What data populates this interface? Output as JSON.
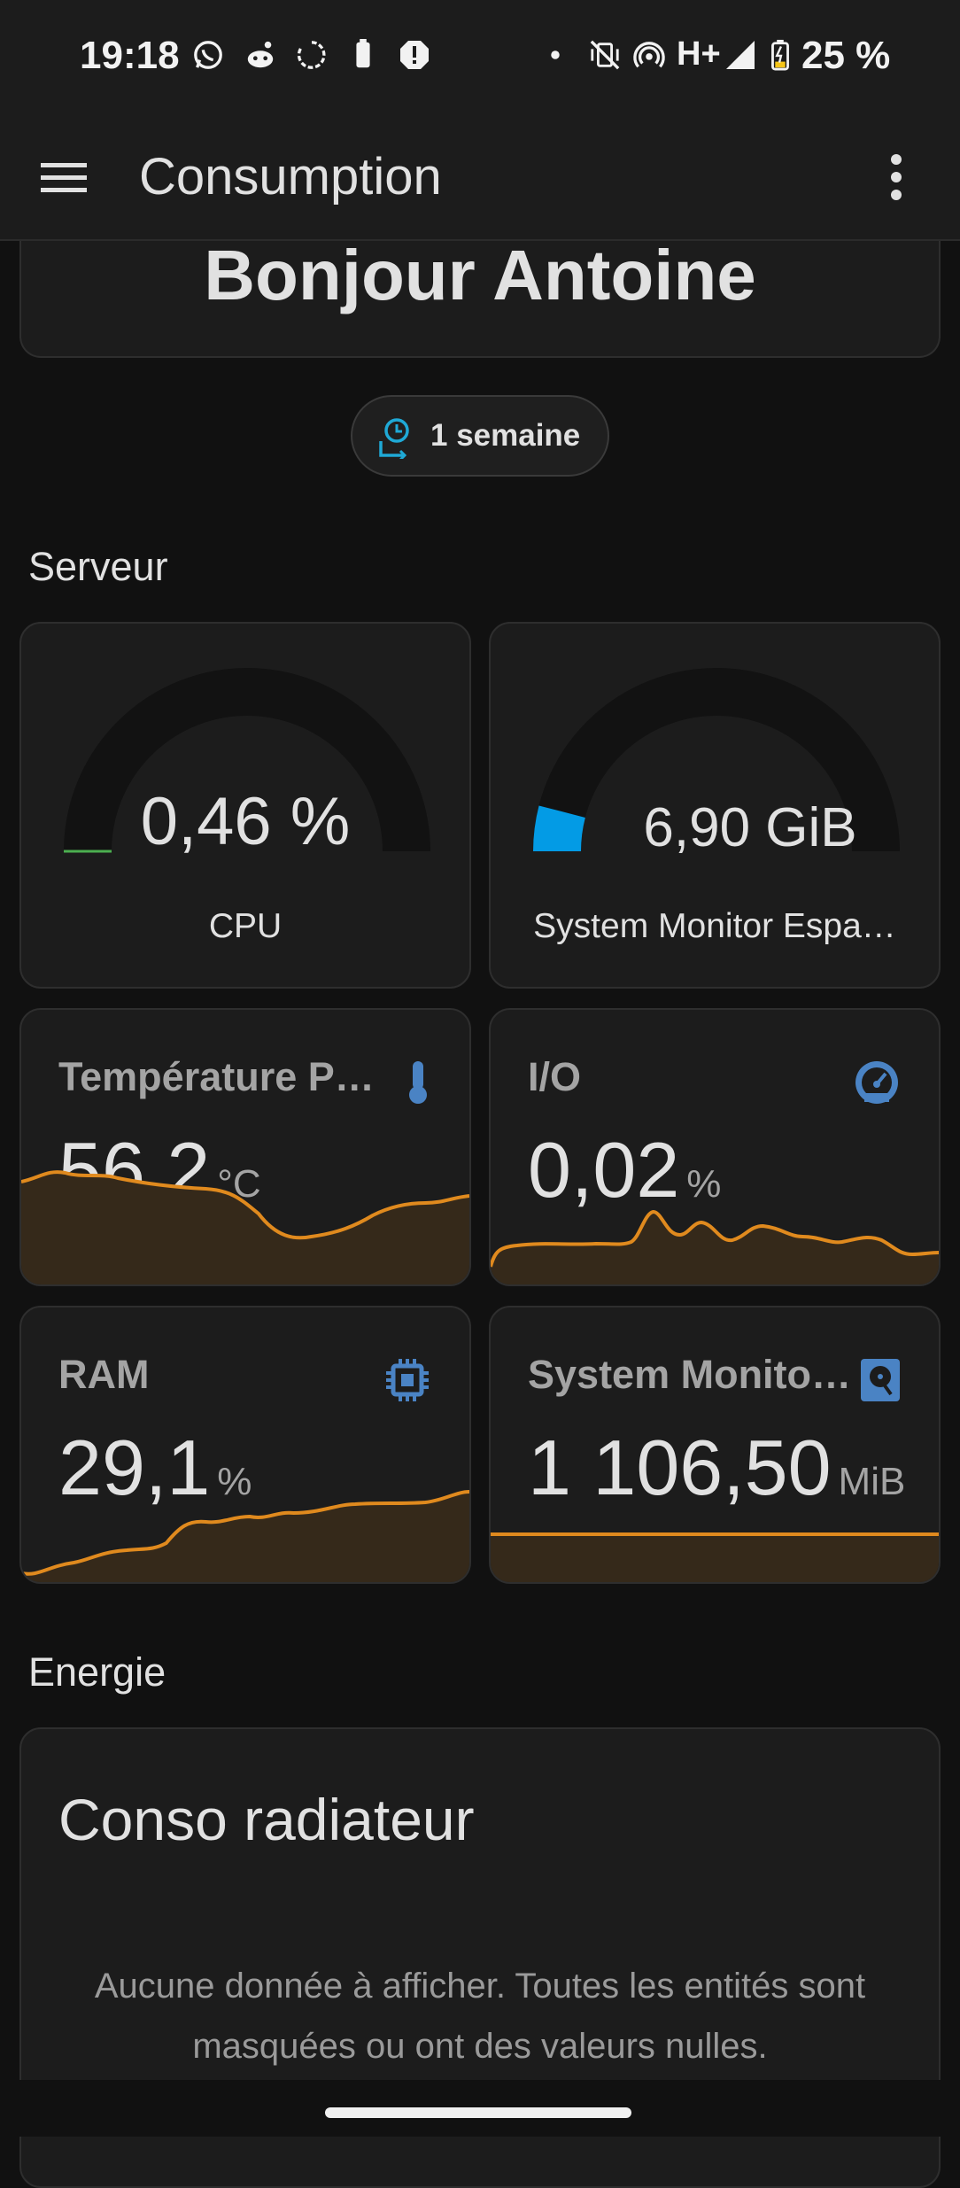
{
  "status_bar": {
    "time": "19:18",
    "network": "H+",
    "battery": "25 %"
  },
  "app_bar": {
    "title": "Consumption"
  },
  "greeting": "Bonjour Antoine",
  "period_chip": {
    "label": "1 semaine"
  },
  "sections": {
    "server": "Serveur",
    "energy": "Energie"
  },
  "gauges": [
    {
      "value": "0,46 %",
      "name": "CPU",
      "fraction": 0.0046,
      "color": "#4caf50"
    },
    {
      "value": "6,90 GiB",
      "name": "System Monitor Espa…",
      "fraction": 0.08,
      "color": "#039be5"
    }
  ],
  "sensors": [
    {
      "name": "Température P…",
      "value": "56,2",
      "unit": "°C",
      "icon": "thermometer-icon"
    },
    {
      "name": "I/O",
      "value": "0,02",
      "unit": "%",
      "icon": "gauge-icon"
    },
    {
      "name": "RAM",
      "value": "29,1",
      "unit": "%",
      "icon": "chip-icon"
    },
    {
      "name": "System Monito…",
      "value": "1 106,50",
      "unit": "MiB",
      "icon": "harddisk-icon"
    }
  ],
  "energy_card": {
    "title": "Conso radiateur",
    "message_line1": "Aucune donnée à afficher. Toutes les entités sont",
    "message_line2": "masquées ou ont des valeurs nulles."
  },
  "colors": {
    "accent_orange": "#e08a1e",
    "icon_blue": "#4a83c4",
    "chip_icon": "#1fa9d6"
  }
}
